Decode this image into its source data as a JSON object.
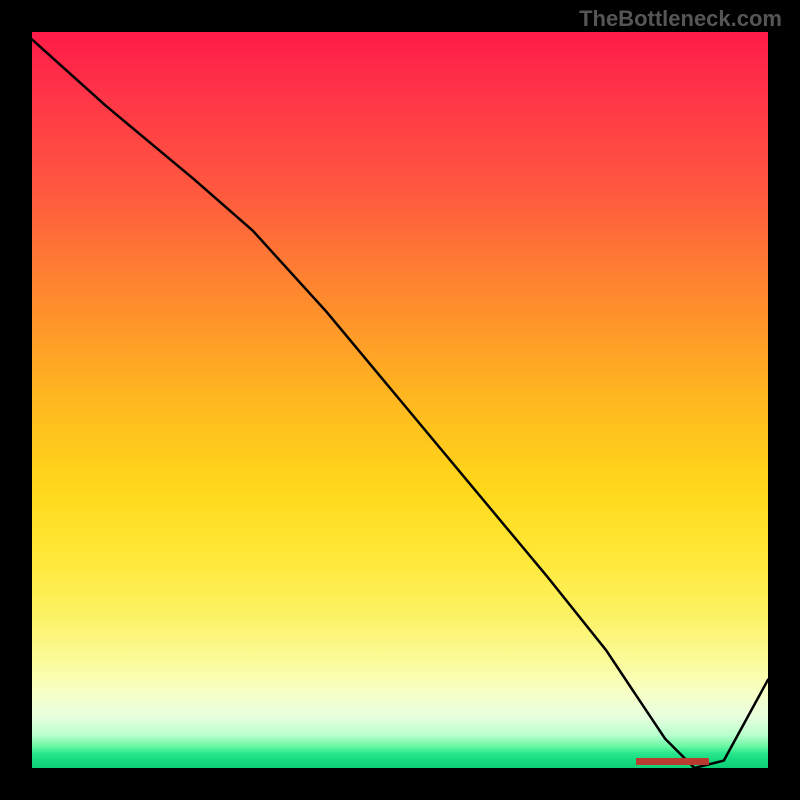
{
  "watermark": "TheBottleneck.com",
  "chart_data": {
    "type": "line",
    "title": "",
    "xlabel": "",
    "ylabel": "",
    "xlim": [
      0,
      100
    ],
    "ylim": [
      0,
      100
    ],
    "x": [
      0,
      10,
      22,
      30,
      40,
      50,
      60,
      70,
      78,
      82,
      86,
      90,
      94,
      100
    ],
    "values": [
      99,
      90,
      80,
      73,
      62,
      50,
      38,
      26,
      16,
      10,
      4,
      0,
      1,
      12
    ],
    "optimal_range_x": [
      82,
      92
    ],
    "gradient_note": "background encodes bottleneck severity: red=high, yellow=mid, green=0",
    "colors": {
      "curve": "#000000",
      "marker": "#b93a2f",
      "top": "#ff1a48",
      "bottom": "#0fce78"
    }
  }
}
